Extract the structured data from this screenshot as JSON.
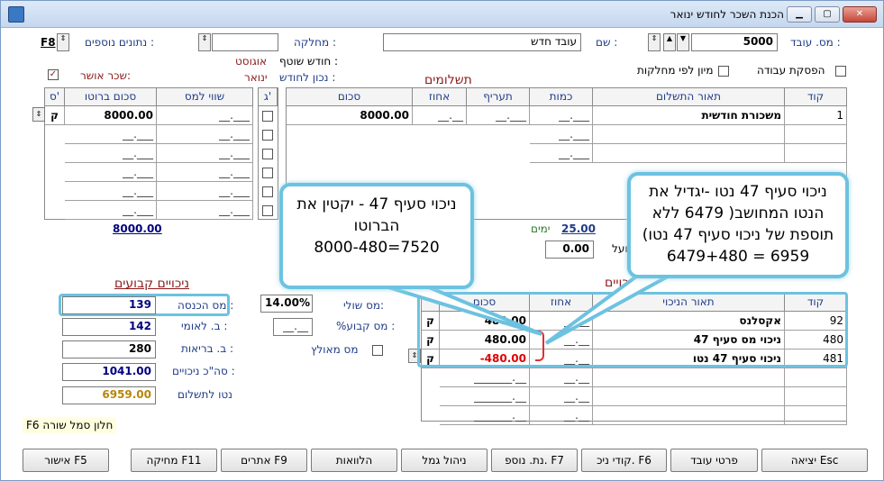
{
  "window": {
    "title": "הכנת השכר לחודש ינואר"
  },
  "header": {
    "employee_no_label": "מס. עובד :",
    "employee_no_value": "5000",
    "name_label": "שם :",
    "name_value": "עובד חדש",
    "department_label": "מחלקה :",
    "department_value": "",
    "extra_data_label": "נתונים נוספים :",
    "extra_data_key": "F8",
    "stop_work_label": "הפסקת עבודה",
    "sort_by_dept_label": "מיון לפי מחלקות",
    "current_month_label": "חודש שוטף :",
    "current_month_value": "אוגוסט",
    "correct_for_month_label": "נכון לחודש :",
    "correct_for_month_value": "ינואר",
    "approved_salary_label": "שכר אושר:",
    "approved_checkmark": "✓"
  },
  "payments": {
    "section_title": "תשלומים",
    "columns": [
      "קוד",
      "תאור התשלום",
      "כמות",
      "תעריף",
      "אחוז",
      "סכום",
      "ג'",
      "שווי למס",
      "סכום ברוטו",
      "ס'"
    ],
    "row1": {
      "code": "1",
      "desc": "משכורת חודשית",
      "qty": "__.___",
      "rate": "__.___",
      "pct": "__.__",
      "amount": "8000.00",
      "value_tax": "__.___",
      "gross": "8000.00",
      "s": "ק"
    },
    "empty_cell": "__.___",
    "gross_total": "8000.00",
    "days_label": "ימים",
    "days_value": "25.00",
    "actual_label": "פועל:",
    "actual_value": "0.00"
  },
  "deductions": {
    "section_title": "ניכויים",
    "columns": [
      "קוד",
      "תאור הניכוי",
      "אחוז",
      "סכום"
    ],
    "rows": [
      {
        "code": "92",
        "desc": "אקסלנס",
        "pct": "__.__",
        "amount": "480.00",
        "s": "ק"
      },
      {
        "code": "480",
        "desc": "ניכוי מס סעיף 47",
        "pct": "__.__",
        "amount": "480.00",
        "s": "ק"
      },
      {
        "code": "481",
        "desc": "ניכוי סעיף 47 נטו",
        "pct": "__.__",
        "amount": "-480.00",
        "s": "ק"
      }
    ],
    "empty_pct": "__.__",
    "empty_amount": "_______.__"
  },
  "fixed_deductions": {
    "section_title": "ניכויים קבועים",
    "income_tax_label": "מס הכנסה :",
    "income_tax_value": "139",
    "national_ins_label": "ב. לאומי :",
    "national_ins_value": "142",
    "health_ins_label": "ב. בריאות :",
    "health_ins_value": "280",
    "total_deductions_label": "סה\"כ ניכויים :",
    "total_deductions_value": "1041.00",
    "net_to_pay_label": "נטו לתשלום",
    "net_to_pay_value": "6959.00",
    "marginal_tax_label": "מס שולי:",
    "marginal_tax_value": "14.00%",
    "fixed_tax_label": "%מס קבוע :",
    "fixed_tax_value": "__.__",
    "forced_tax_label": "מס מאולץ"
  },
  "hint": "F6 חלון סמל שורה",
  "callouts": {
    "left": [
      "ניכוי סעיף 47 - יקטין את",
      "הברוטו",
      "8000-480=7520"
    ],
    "right": [
      "ניכוי סעיף 47 נטו -יגדיל את",
      "הנטו המחושב( 6479 ללא",
      "(תוספת של ניכוי סעיף 47 נטו",
      "6479+480 = 6959"
    ]
  },
  "buttons": {
    "exit": "יציאה Esc",
    "employee_details": "פרטי עובד",
    "deduction_codes": "קודי ניכ. F6",
    "extra_data": "נת. נוספ. F7",
    "provident_fund": "ניהול גמל",
    "loans": "הלוואות",
    "alerts": "אתרים F9",
    "delete": "מחיקה F11",
    "approve": "אישור F5"
  }
}
